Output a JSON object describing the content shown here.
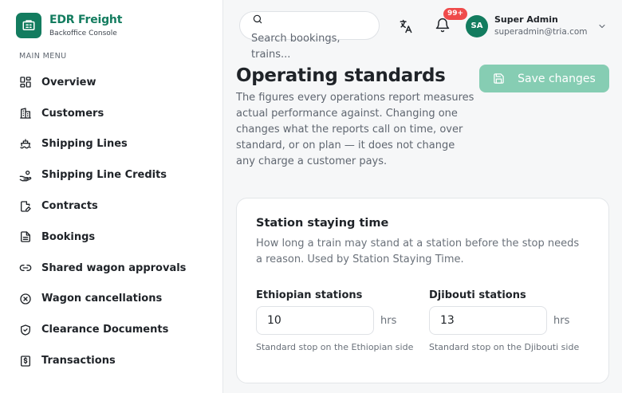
{
  "brand": {
    "title": "EDR Freight",
    "subtitle": "Backoffice Console"
  },
  "sidebar": {
    "heading": "MAIN MENU",
    "items": [
      {
        "label": "Overview",
        "icon": "grid-icon"
      },
      {
        "label": "Customers",
        "icon": "building-icon"
      },
      {
        "label": "Shipping Lines",
        "icon": "ship-icon"
      },
      {
        "label": "Shipping Line Credits",
        "icon": "hand-coins-icon"
      },
      {
        "label": "Contracts",
        "icon": "file-edit-icon"
      },
      {
        "label": "Bookings",
        "icon": "file-text-icon"
      },
      {
        "label": "Shared wagon approvals",
        "icon": "link-icon"
      },
      {
        "label": "Wagon cancellations",
        "icon": "x-circle-icon"
      },
      {
        "label": "Clearance Documents",
        "icon": "shield-check-icon"
      },
      {
        "label": "Transactions",
        "icon": "dollar-receipt-icon"
      }
    ]
  },
  "header": {
    "search_placeholder": "Search bookings, trains...",
    "notifications_badge": "99+",
    "user": {
      "initials": "SA",
      "name": "Super Admin",
      "email": "superadmin@tria.com"
    }
  },
  "page": {
    "title": "Operating standards",
    "description": "The figures every operations report measures actual performance against. Changing one changes what the reports call on time, over standard, or on plan — it does not change any charge a customer pays.",
    "save_label": "Save changes"
  },
  "card": {
    "title": "Station staying time",
    "description": "How long a train may stand at a station before the stop needs a reason. Used by Station Staying Time.",
    "fields": [
      {
        "label": "Ethiopian stations",
        "value": "10",
        "unit": "hrs",
        "hint": "Standard stop on the Ethiopian side"
      },
      {
        "label": "Djibouti stations",
        "value": "13",
        "unit": "hrs",
        "hint": "Standard stop on the Djibouti side"
      }
    ]
  },
  "colors": {
    "brand": "#137c5f",
    "save_button": "#86cdb3",
    "badge": "#ef4b4b"
  }
}
